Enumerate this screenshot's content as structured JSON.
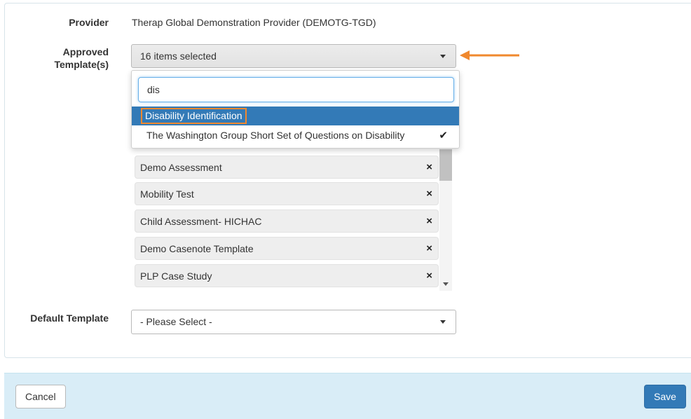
{
  "form": {
    "provider_label": "Provider",
    "provider_value": "Therap Global Demonstration Provider (DEMOTG-TGD)",
    "approved_label_line1": "Approved",
    "approved_label_line2": "Template(s)",
    "approved_select_text": "16 items selected",
    "default_label": "Default Template",
    "default_select_text": "- Please Select -"
  },
  "dropdown": {
    "search_value": "dis",
    "options": [
      {
        "label": "Disability Identification",
        "highlighted": true,
        "checked": false
      },
      {
        "label": "The Washington Group Short Set of Questions on Disability",
        "highlighted": false,
        "checked": true
      }
    ]
  },
  "selected_items": [
    {
      "label": "Demo Assessment"
    },
    {
      "label": "Mobility Test"
    },
    {
      "label": "Child Assessment- HICHAC"
    },
    {
      "label": "Demo Casenote Template"
    },
    {
      "label": "PLP Case Study"
    }
  ],
  "icons": {
    "remove": "×",
    "check": "✔"
  },
  "footer": {
    "cancel_label": "Cancel",
    "save_label": "Save"
  },
  "colors": {
    "primary": "#337ab7",
    "annotation": "#f0882e",
    "footer_bg": "#d9edf7"
  }
}
